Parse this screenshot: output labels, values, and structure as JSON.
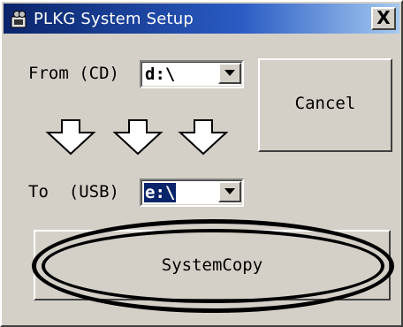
{
  "window": {
    "title": "PLKG System Setup",
    "close_label": "X"
  },
  "from": {
    "label": "From (CD)",
    "value": "d:\\"
  },
  "to": {
    "label": "To  (USB)",
    "value": "e:\\"
  },
  "buttons": {
    "cancel": "Cancel",
    "system_copy": "SystemCopy"
  },
  "icons": {
    "app": "app-icon",
    "arrows": [
      "down-arrow-icon",
      "down-arrow-icon",
      "down-arrow-icon"
    ]
  },
  "colors": {
    "title_bar": "#0a246a",
    "selection": "#0a246a",
    "face": "#d4d0c8"
  }
}
